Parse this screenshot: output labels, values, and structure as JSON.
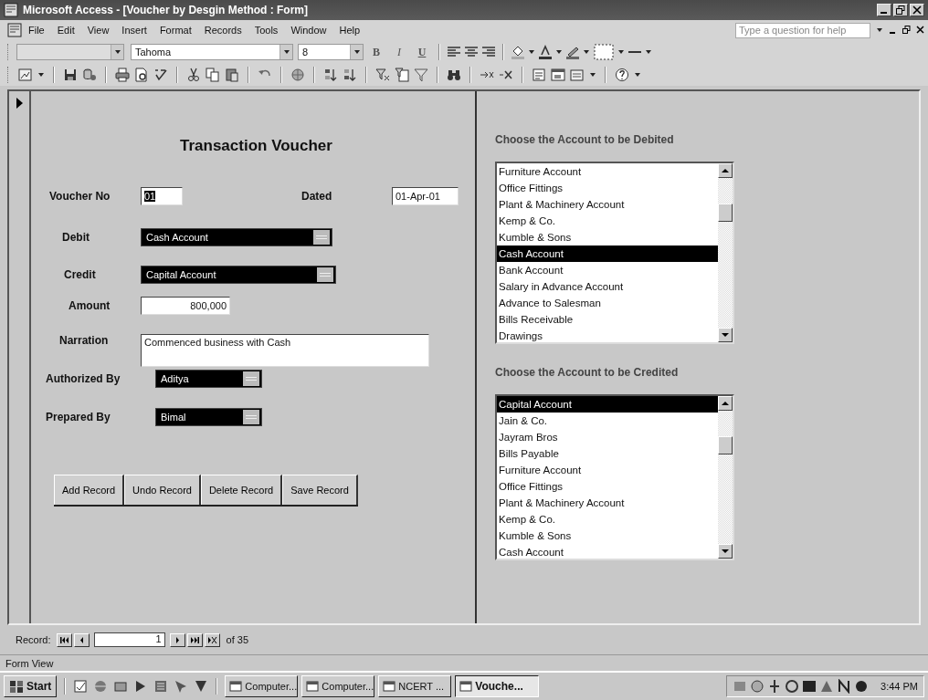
{
  "window": {
    "title": "Microsoft Access - [Voucher by Desgin Method : Form]"
  },
  "menu": [
    "File",
    "Edit",
    "View",
    "Insert",
    "Format",
    "Records",
    "Tools",
    "Window",
    "Help"
  ],
  "help_box": {
    "placeholder": "Type a question for help"
  },
  "format_toolbar": {
    "font": "Tahoma",
    "font_size": "8",
    "style_buttons": [
      "B",
      "I",
      "U"
    ]
  },
  "form": {
    "title": "Transaction Voucher",
    "fields": [
      {
        "kind": "text",
        "label": "Voucher No",
        "value": "01"
      },
      {
        "kind": "text",
        "label": "Dated",
        "value": "01-Apr-01"
      },
      {
        "kind": "combo",
        "label": "Debit",
        "value": "Cash Account"
      },
      {
        "kind": "combo",
        "label": "Credit",
        "value": "Capital Account"
      },
      {
        "kind": "number",
        "label": "Amount",
        "value": "800,000"
      },
      {
        "kind": "memo",
        "label": "Narration",
        "value": "Commenced business with Cash"
      },
      {
        "kind": "combo",
        "label": "Authorized By",
        "value": "Aditya"
      },
      {
        "kind": "combo",
        "label": "Prepared By",
        "value": "Bimal"
      }
    ],
    "buttons": [
      "Add Record",
      "Undo Record",
      "Delete Record",
      "Save Record"
    ]
  },
  "debit_list": {
    "label": "Choose the Account to be Debited",
    "items": [
      {
        "text": "Furniture Account",
        "selected": false
      },
      {
        "text": "Office Fittings",
        "selected": false
      },
      {
        "text": "Plant & Machinery Account",
        "selected": false
      },
      {
        "text": "Kemp & Co.",
        "selected": false
      },
      {
        "text": "Kumble & Sons",
        "selected": false
      },
      {
        "text": "Cash Account",
        "selected": true
      },
      {
        "text": "Bank Account",
        "selected": false
      },
      {
        "text": "Salary in Advance Account",
        "selected": false
      },
      {
        "text": "Advance to Salesman",
        "selected": false
      },
      {
        "text": "Bills Receivable",
        "selected": false
      },
      {
        "text": "Drawings",
        "selected": false
      }
    ]
  },
  "credit_list": {
    "label": "Choose the Account to be Credited",
    "items": [
      {
        "text": "Capital Account",
        "selected": true
      },
      {
        "text": "Jain & Co.",
        "selected": false
      },
      {
        "text": "Jayram Bros",
        "selected": false
      },
      {
        "text": "Bills Payable",
        "selected": false
      },
      {
        "text": "Furniture Account",
        "selected": false
      },
      {
        "text": "Office Fittings",
        "selected": false
      },
      {
        "text": "Plant & Machinery Account",
        "selected": false
      },
      {
        "text": "Kemp & Co.",
        "selected": false
      },
      {
        "text": "Kumble & Sons",
        "selected": false
      },
      {
        "text": "Cash Account",
        "selected": false
      }
    ]
  },
  "navigation": {
    "label": "Record:",
    "current": "1",
    "total": "of 35"
  },
  "status_bar": {
    "text": "Form View"
  },
  "taskbar": {
    "start": "Start",
    "tasks": [
      {
        "label": "Computer...",
        "selected": false
      },
      {
        "label": "Computer...",
        "selected": false
      },
      {
        "label": "NCERT ...",
        "selected": false
      },
      {
        "label": "Vouche...",
        "selected": true
      }
    ],
    "clock": "3:44 PM"
  }
}
